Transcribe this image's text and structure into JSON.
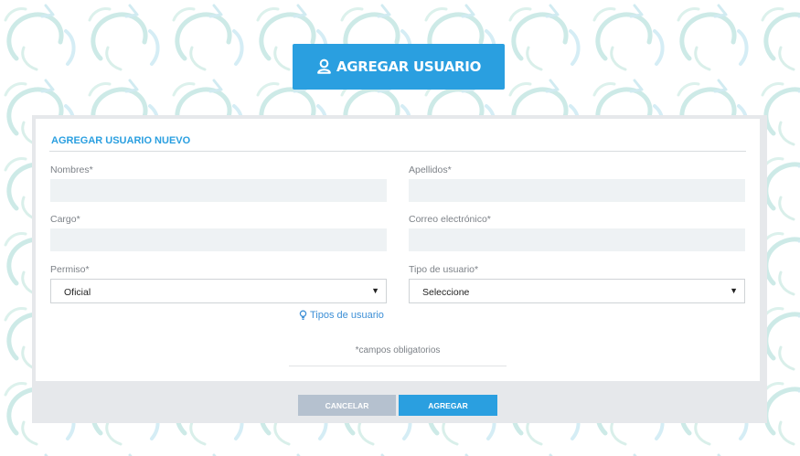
{
  "header": {
    "title": "AGREGAR USUARIO",
    "icon": "user-icon"
  },
  "form": {
    "section_title": "AGREGAR USUARIO NUEVO",
    "fields": {
      "nombres": {
        "label": "Nombres*",
        "value": ""
      },
      "apellidos": {
        "label": "Apellidos*",
        "value": ""
      },
      "cargo": {
        "label": "Cargo*",
        "value": ""
      },
      "correo": {
        "label": "Correo electrónico*",
        "value": ""
      },
      "permiso": {
        "label": "Permiso*",
        "selected": "Oficial"
      },
      "tipo_usuario": {
        "label": "Tipo de usuario*",
        "selected": "Seleccione"
      }
    },
    "tipos_link": {
      "label": "Tipos de usuario",
      "icon": "lightbulb-icon"
    },
    "required_note": "*campos obligatorios"
  },
  "actions": {
    "cancel_label": "CANCELAR",
    "add_label": "AGREGAR"
  },
  "colors": {
    "accent": "#2a9fe0",
    "cancel": "#b5c1cf",
    "panel": "#e6e8eb",
    "input_bg": "#eef2f4"
  }
}
